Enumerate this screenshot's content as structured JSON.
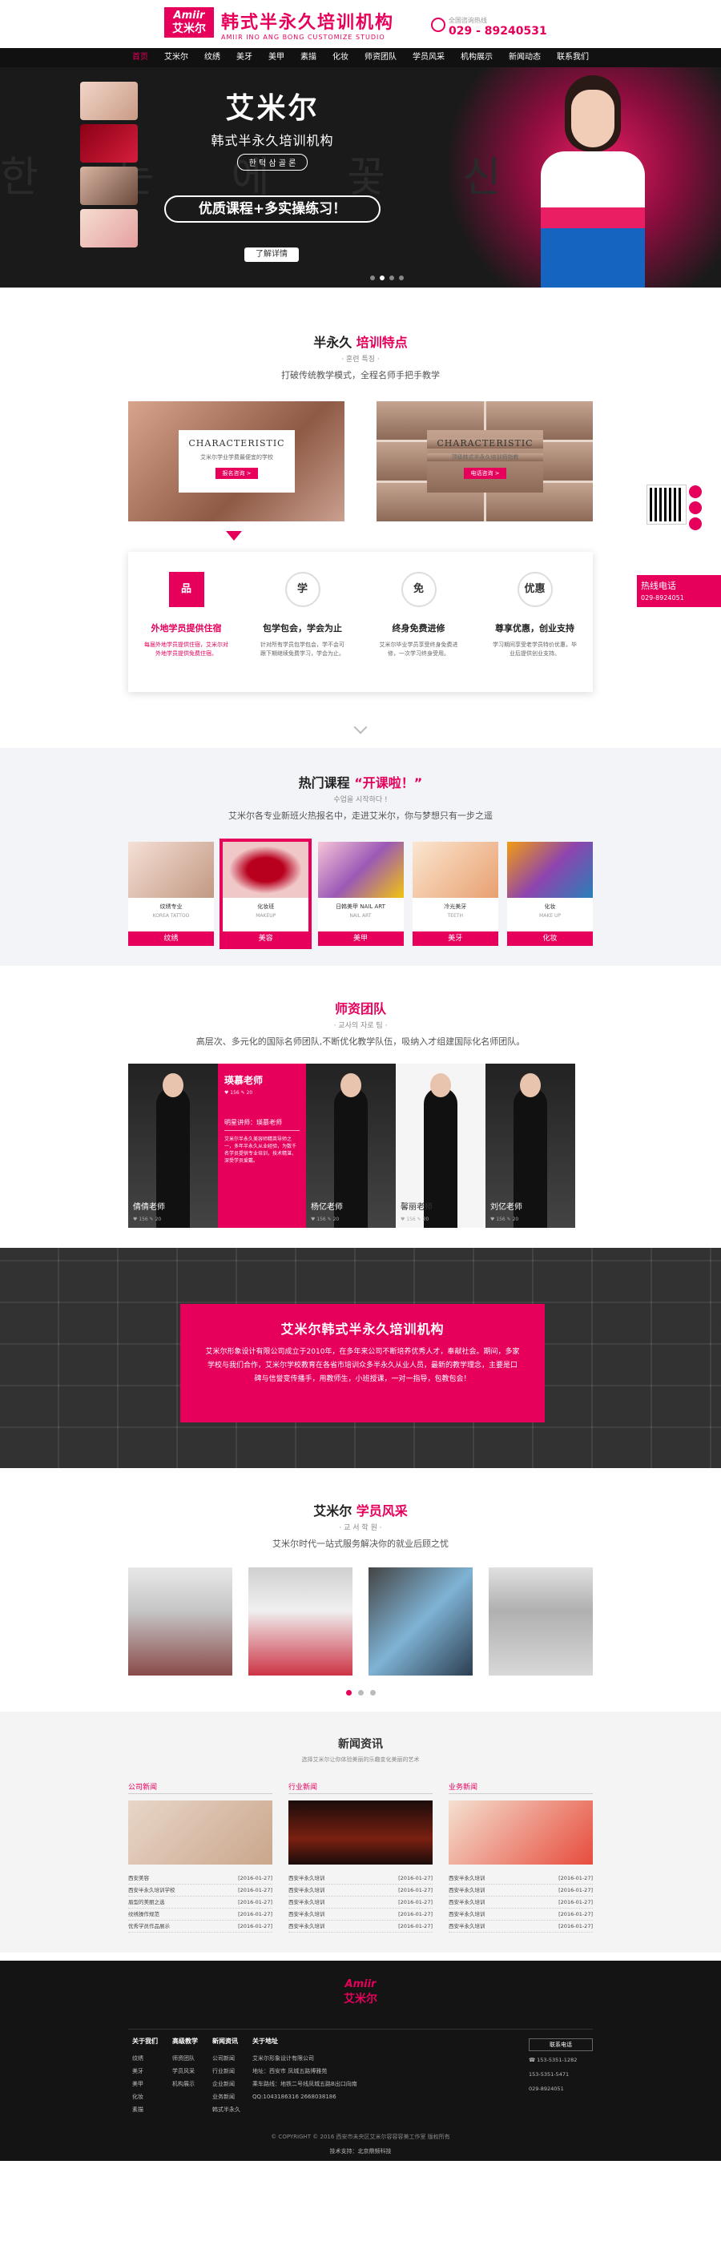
{
  "header": {
    "logo_en": "Amiir",
    "logo_cn": "艾米尔",
    "brand_title": "韩式半永久培训机构",
    "brand_sub": "AMIIR INO ANG BONG CUSTOMIZE STUDIO",
    "hotline_label": "全国咨询热线",
    "hotline": "029 - 89240531"
  },
  "nav": [
    "首页",
    "艾米尔",
    "纹绣",
    "美牙",
    "美甲",
    "素描",
    "化妆",
    "师资团队",
    "学员风采",
    "机构展示",
    "新闻动态",
    "联系我们"
  ],
  "banner": {
    "ghost": "한 눈 에 꽃 신",
    "title": "艾米尔",
    "subtitle": "韩式半永久培训机构",
    "korean": "한 턱 삼 골 론",
    "slogan": "优质课程+多实操练习！",
    "button": "了解详情"
  },
  "features": {
    "title_a": "半永久",
    "title_b": "培训特点",
    "kr": "· 훈련 특징 ·",
    "desc": "打破传统教学模式，全程名师手把手教学",
    "cards": [
      {
        "en": "CHARACTERISTIC",
        "cn": "艾米尔学业学费最便宜的学校",
        "btn": "报名咨询 >"
      },
      {
        "en": "CHARACTERISTIC",
        "cn": "顶级韩式半永久培训师指教",
        "btn": "电话咨询 >"
      }
    ],
    "items": [
      {
        "icon": "品",
        "title": "外地学员提供住宿",
        "text": "每届外地学员提供住宿，艾米尔对外地学员提供免费住宿。"
      },
      {
        "icon": "学",
        "title": "包学包会，学会为止",
        "text": "针对所有学员包学包会，学不会可跟下期继续免费学习，学会为止。"
      },
      {
        "icon": "免",
        "title": "终身免费进修",
        "text": "艾米尔毕业学员享受终身免费进修，一次学习终身受用。"
      },
      {
        "icon": "优惠",
        "title": "尊享优惠，创业支持",
        "text": "学习期间享受老学员特价优惠，毕业后提供创业支持。"
      }
    ]
  },
  "courses": {
    "title_a": "热门课程",
    "title_b": "“开课啦！”",
    "kr": "수업을 시작하다 !",
    "desc": "艾米尔各专业新班火热报名中，走进艾米尔，你与梦想只有一步之遥",
    "items": [
      {
        "a": "纹绣专业",
        "b": "KOREA TATTOO",
        "label": "纹绣"
      },
      {
        "a": "化妆班",
        "b": "MAKEUP",
        "label": "美容"
      },
      {
        "a": "日韩美甲 NAIL ART",
        "b": "NAIL ART",
        "label": "美甲"
      },
      {
        "a": "冷光美牙",
        "b": "TEETH",
        "label": "美牙"
      },
      {
        "a": "化妆",
        "b": "MAKE UP",
        "label": "化妆"
      }
    ]
  },
  "teachers": {
    "title": "师资团队",
    "kr": "· 교사의 자로 팀 ·",
    "desc": "高层次、多元化的国际名师团队,不断优化教学队伍，吸纳入才组建国际化名师团队。",
    "featured": {
      "name": "瑛慕老师",
      "stats": "♥ 156   ✎ 20",
      "role": "明星讲师：瑛慕老师",
      "text": "艾米尔半永久美容师精英导师之一，多年半永久从业经验，为数千名学员提供专业培训，技术精湛，深受学员爱戴。"
    },
    "list": [
      {
        "name": "倩倩老师",
        "meta": "♥ 156   ✎ 20"
      },
      {
        "name": "杨亿老师",
        "meta": "♥ 156   ✎ 20"
      },
      {
        "name": "馨丽老师",
        "meta": "♥ 156   ✎ 20"
      },
      {
        "name": "刘亿老师",
        "meta": "♥ 156   ✎ 20"
      }
    ]
  },
  "about": {
    "title": "艾米尔韩式半永久培训机构",
    "text": "艾米尔形象设计有限公司成立于2010年，在多年来公司不断培养优秀人才，奉献社会。期间，多家学校与我们合作，艾米尔学校教育在各省市培训众多半永久从业人员，最新的教学理念，主要是口碑与信誉变传播手，用教师生，小班授课，一对一指导，包教包会！"
  },
  "students": {
    "title_a": "艾米尔",
    "title_b": "学员风采",
    "kr": "· 교 서 학 원 ·",
    "desc": "艾米尔时代一站式服务解决你的就业后顾之忧"
  },
  "news": {
    "title": "新闻资讯",
    "desc": "选择艾米尔让你体验美丽的乐趣变化美丽的艺术",
    "cols": [
      {
        "head": "公司新闻",
        "items": [
          [
            "西安美容",
            "[2016-01-27]"
          ],
          [
            "西安半永久培训学校",
            "[2016-01-27]"
          ],
          [
            "眉型的美丽之选",
            "[2016-01-27]"
          ],
          [
            "纹绣操作规范",
            "[2016-01-27]"
          ],
          [
            "优秀学员作品展示",
            "[2016-01-27]"
          ]
        ]
      },
      {
        "head": "行业新闻",
        "items": [
          [
            "西安半永久培训",
            "[2016-01-27]"
          ],
          [
            "西安半永久培训",
            "[2016-01-27]"
          ],
          [
            "西安半永久培训",
            "[2016-01-27]"
          ],
          [
            "西安半永久培训",
            "[2016-01-27]"
          ],
          [
            "西安半永久培训",
            "[2016-01-27]"
          ]
        ]
      },
      {
        "head": "业务新闻",
        "items": [
          [
            "西安半永久培训",
            "[2016-01-27]"
          ],
          [
            "西安半永久培训",
            "[2016-01-27]"
          ],
          [
            "西安半永久培训",
            "[2016-01-27]"
          ],
          [
            "西安半永久培训",
            "[2016-01-27]"
          ],
          [
            "西安半永久培训",
            "[2016-01-27]"
          ]
        ]
      }
    ]
  },
  "footer": {
    "logo_en": "Amiir",
    "logo_cn": "艾米尔",
    "cols": [
      {
        "h": "关于我们",
        "items": [
          "纹绣",
          "美牙",
          "美甲",
          "化妆",
          "素描"
        ]
      },
      {
        "h": "高级教学",
        "items": [
          "师资团队",
          "学员风采",
          "机构展示"
        ]
      },
      {
        "h": "新闻资讯",
        "items": [
          "公司新闻",
          "行业新闻",
          "企业新闻",
          "业务新闻",
          "韩式半永久"
        ]
      }
    ],
    "contact_h": "关于地址",
    "contact": [
      "艾米尔形象设计有限公司",
      "地址：西安市 凤城五路博雅苑",
      "乘车路线：地铁二号线凤城五路B出口向南",
      "QQ:1043186316   2668038186"
    ],
    "side_btn": "联系电话",
    "phones": [
      "☎ 153-5351-1282",
      "153-5351-5471",
      "029-8924051"
    ],
    "copyright": "© COPYRIGHT © 2016 西安市未央区艾米尔容容容美工作室 版权所有",
    "tech": "技术支持：北京鼎频科技"
  },
  "float": {
    "hot_label": "热线电话",
    "hot_number": "029-8924051"
  }
}
